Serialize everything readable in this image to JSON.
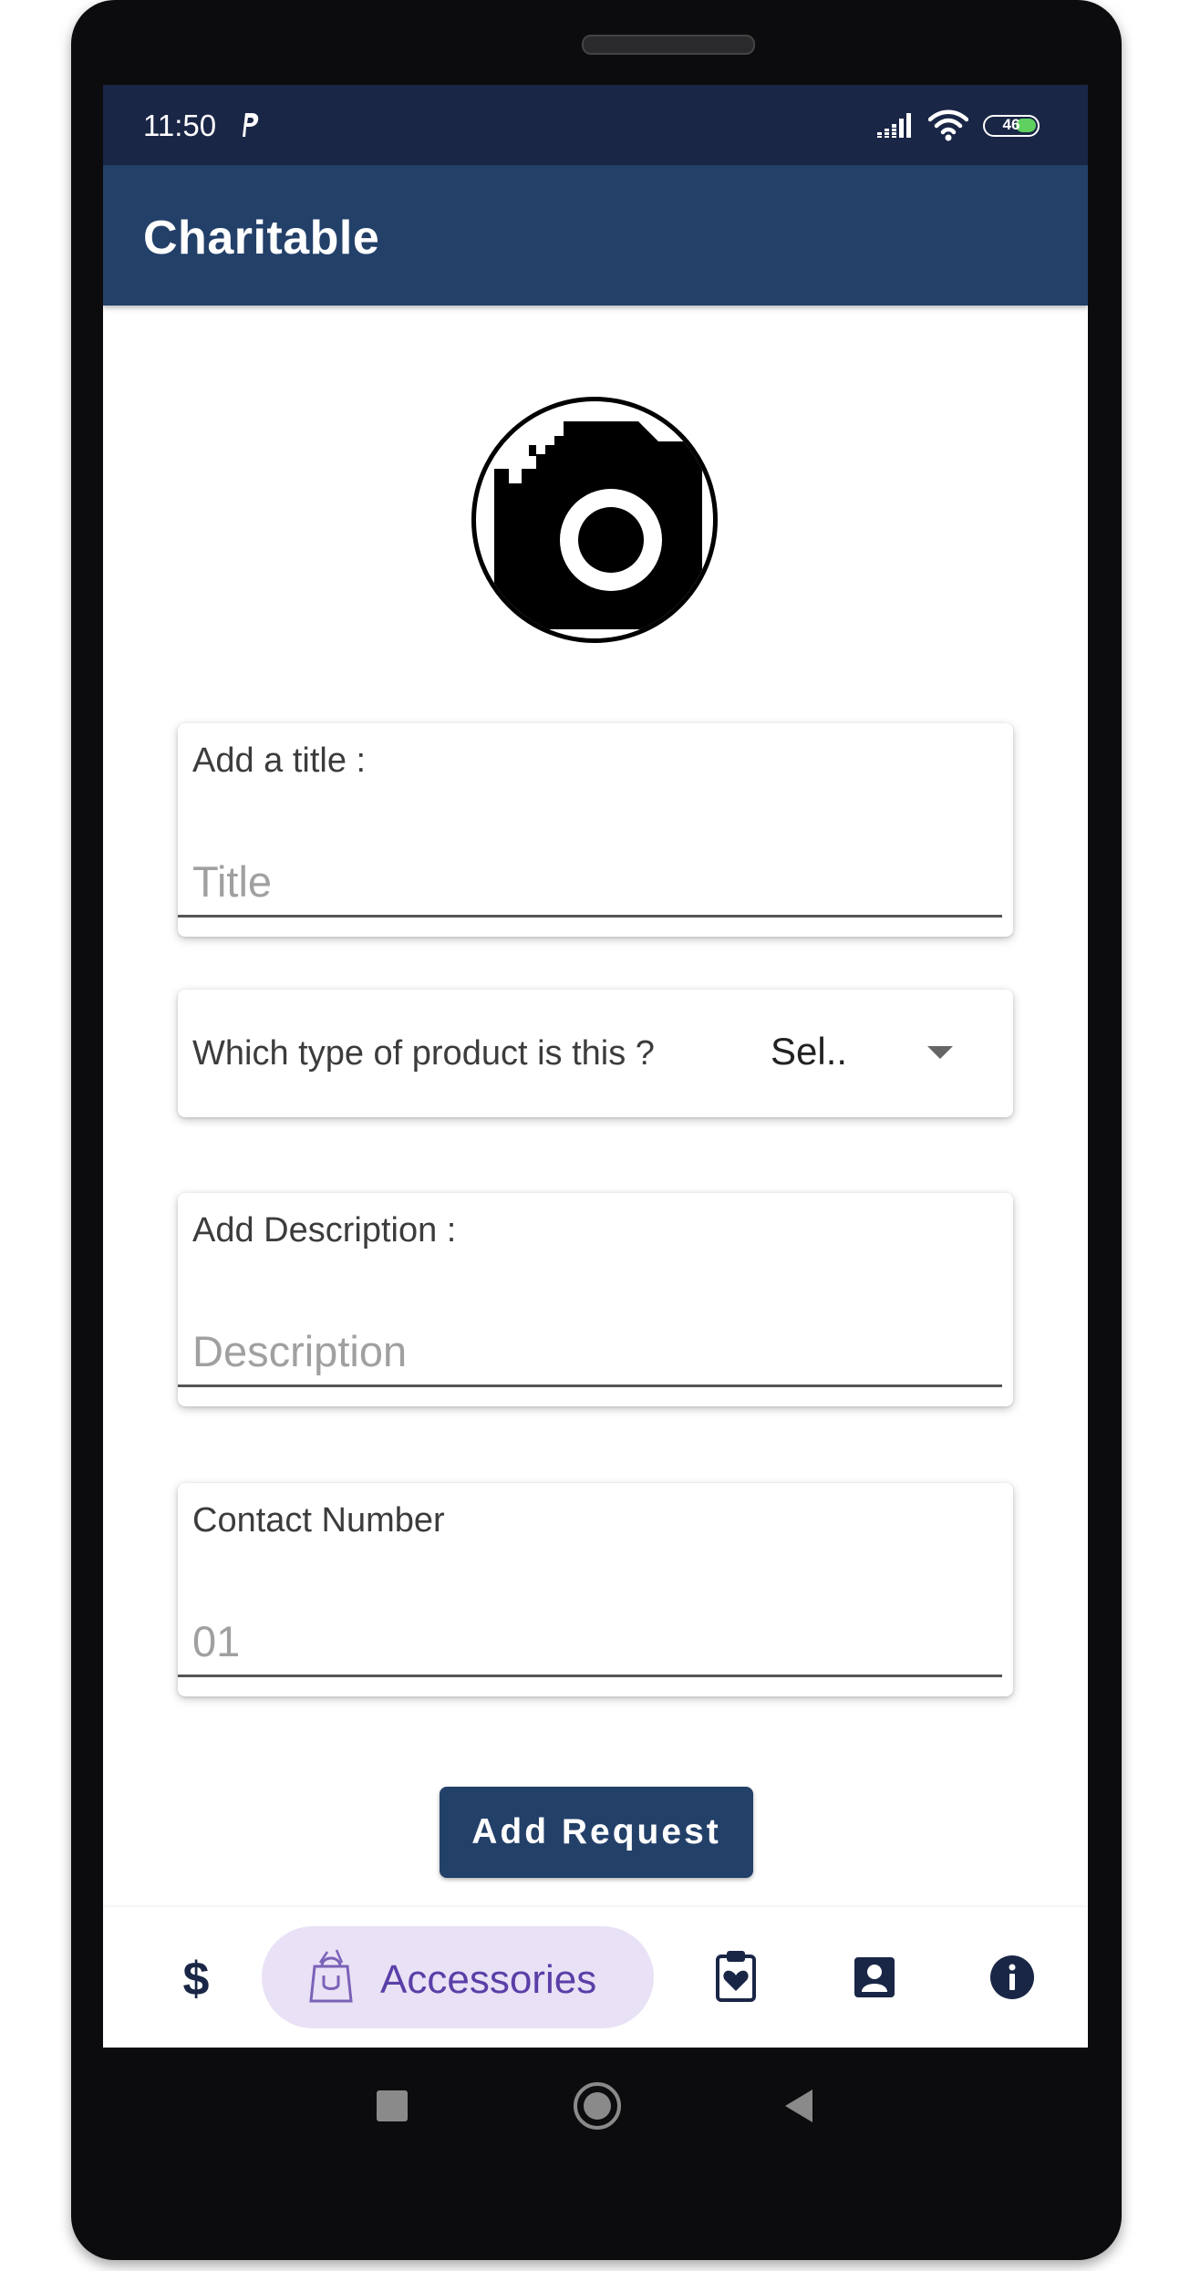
{
  "status_bar": {
    "time": "11:50",
    "notification_icon": "parking-p-icon",
    "battery_level": "46",
    "icons": [
      "signal-icon",
      "wifi-icon",
      "battery-icon"
    ]
  },
  "app_bar": {
    "title": "Charitable"
  },
  "photo": {
    "icon": "camera-add-icon"
  },
  "form": {
    "title_field": {
      "label": "Add a title :",
      "placeholder": "Title",
      "value": ""
    },
    "product_type": {
      "question": "Which type of product is this ?",
      "selected": "Sel.."
    },
    "description_field": {
      "label": "Add Description :",
      "placeholder": "Description",
      "value": ""
    },
    "contact_field": {
      "label": "Contact Number",
      "placeholder": "01",
      "value": ""
    },
    "submit_label": "Add Request"
  },
  "bottom_nav": {
    "items": [
      {
        "icon": "dollar-icon",
        "label": ""
      },
      {
        "icon": "shopping-bag-icon",
        "label": "Accessories",
        "active": true
      },
      {
        "icon": "clipboard-heart-icon",
        "label": ""
      },
      {
        "icon": "contact-card-icon",
        "label": ""
      },
      {
        "icon": "info-icon",
        "label": ""
      }
    ]
  },
  "system_nav": {
    "icons": [
      "recents-square-icon",
      "home-circle-icon",
      "back-triangle-icon"
    ]
  },
  "colors": {
    "status_bar": "#1a2646",
    "app_bar": "#234069",
    "button": "#234069",
    "nav_active_pill": "#e9e1f5",
    "nav_active_text": "#5a3fa8",
    "nav_icon": "#1a2646"
  }
}
